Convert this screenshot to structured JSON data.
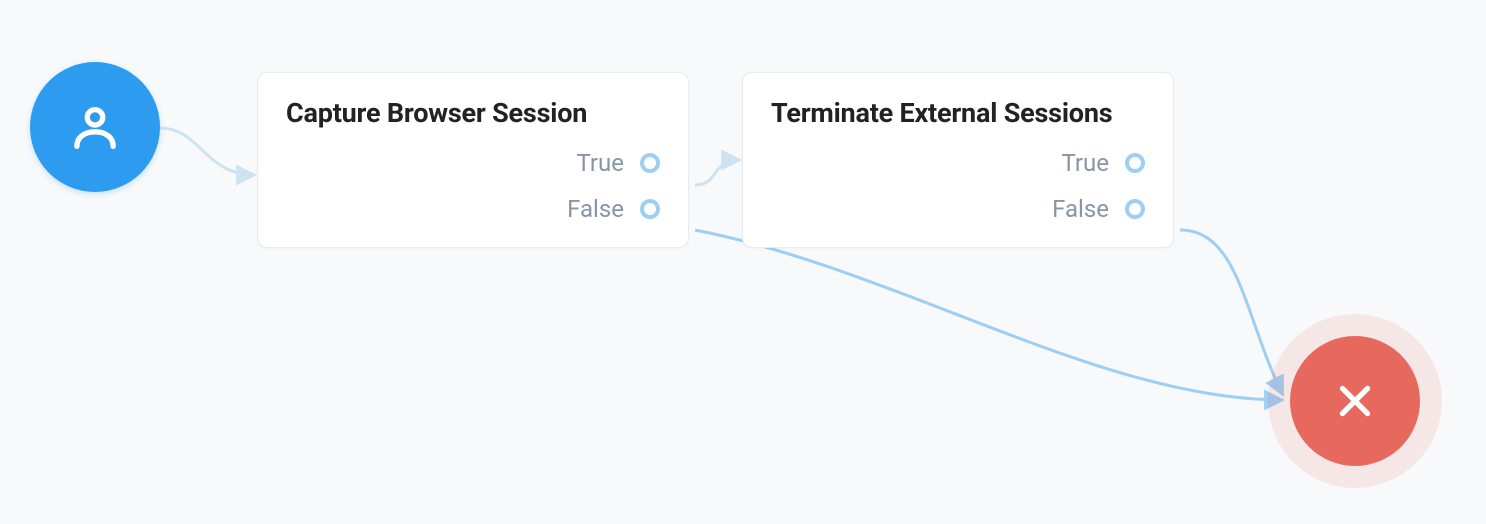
{
  "colors": {
    "start": "#2d9cf0",
    "end": "#e7695d",
    "wire_light": "#cde3f1",
    "wire": "#9dcff5",
    "port": "#9dcff5"
  },
  "nodes": {
    "start": {
      "icon": "user-icon"
    },
    "step1": {
      "title": "Capture Browser Session",
      "outputs": [
        {
          "label": "True"
        },
        {
          "label": "False"
        }
      ]
    },
    "step2": {
      "title": "Terminate External Sessions",
      "outputs": [
        {
          "label": "True"
        },
        {
          "label": "False"
        }
      ]
    },
    "end": {
      "icon": "x-icon"
    }
  }
}
